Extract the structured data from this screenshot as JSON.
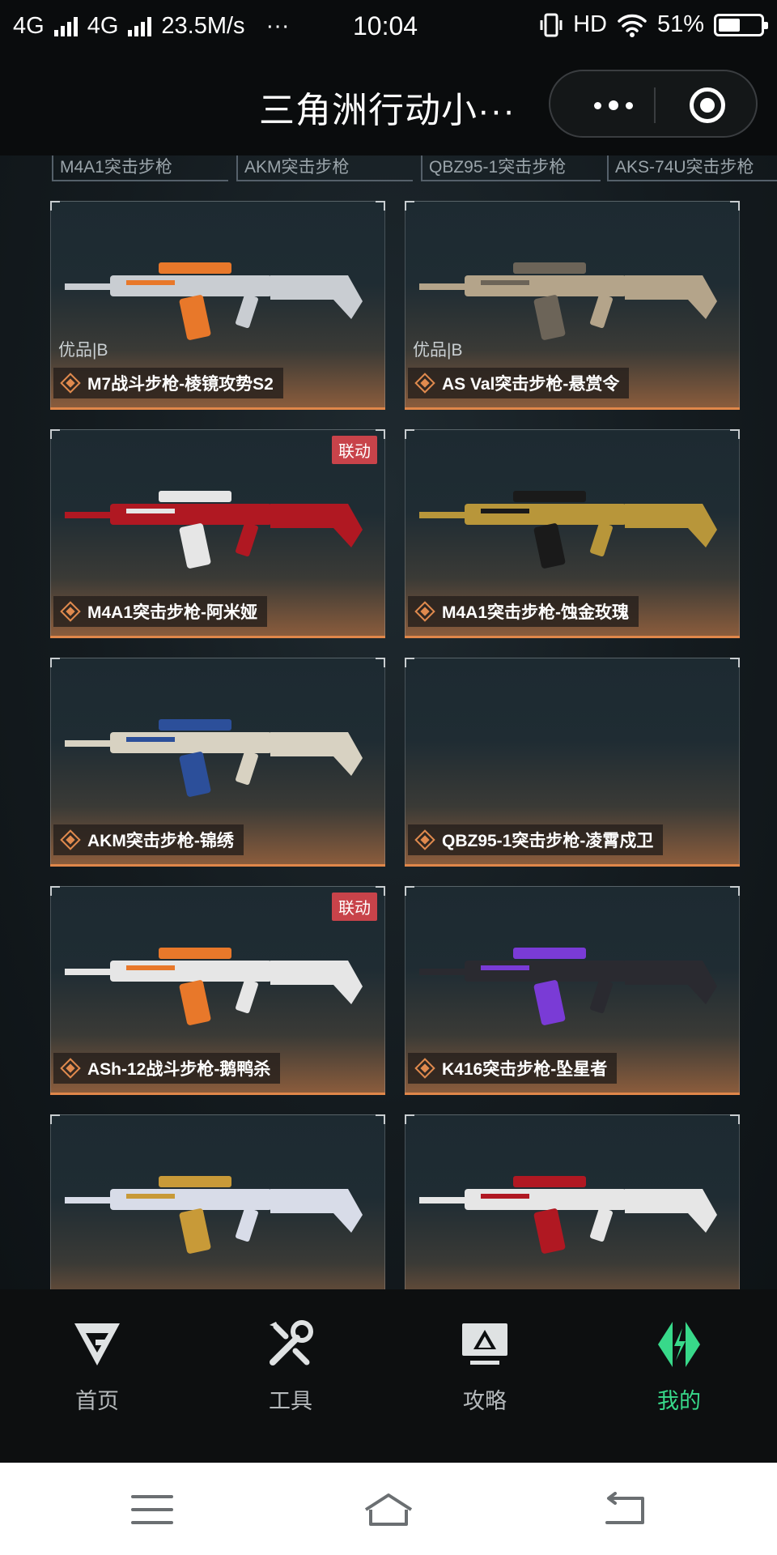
{
  "status_bar": {
    "network1": "4G",
    "network2": "4G",
    "speed": "23.5M/s",
    "more": "···",
    "time": "10:04",
    "hd": "HD",
    "battery": "51%",
    "battery_level": 0.51
  },
  "title_bar": {
    "title": "三角洲行动小···"
  },
  "filter_tabs": [
    "M4A1突击步枪",
    "AKM突击步枪",
    "QBZ95-1突击步枪",
    "AKS-74U突击步枪"
  ],
  "cards": [
    {
      "name": "M7战斗步枪-棱镜攻势S2",
      "grade": "优品|B",
      "collab": ""
    },
    {
      "name": "AS Val突击步枪-悬赏令",
      "grade": "优品|B",
      "collab": ""
    },
    {
      "name": "M4A1突击步枪-阿米娅",
      "grade": "",
      "collab": "联动"
    },
    {
      "name": "M4A1突击步枪-蚀金玫瑰",
      "grade": "",
      "collab": ""
    },
    {
      "name": "AKM突击步枪-锦绣",
      "grade": "",
      "collab": ""
    },
    {
      "name": "QBZ95-1突击步枪-凌霄戍卫",
      "grade": "",
      "collab": ""
    },
    {
      "name": "ASh-12战斗步枪-鹅鸭杀",
      "grade": "",
      "collab": "联动"
    },
    {
      "name": "K416突击步枪-坠星者",
      "grade": "",
      "collab": ""
    },
    {
      "name": "",
      "grade": "",
      "collab": ""
    },
    {
      "name": "",
      "grade": "",
      "collab": ""
    }
  ],
  "bottom_nav": {
    "items": [
      {
        "label": "首页",
        "icon": "home-logo-icon",
        "active": false
      },
      {
        "label": "工具",
        "icon": "tools-icon",
        "active": false
      },
      {
        "label": "攻略",
        "icon": "guide-monitor-icon",
        "active": false
      },
      {
        "label": "我的",
        "icon": "profile-logo-icon",
        "active": true
      }
    ]
  },
  "colors": {
    "accent_orange": "#e0874a",
    "collab_red": "#c8434a",
    "active_green": "#38d98a"
  }
}
